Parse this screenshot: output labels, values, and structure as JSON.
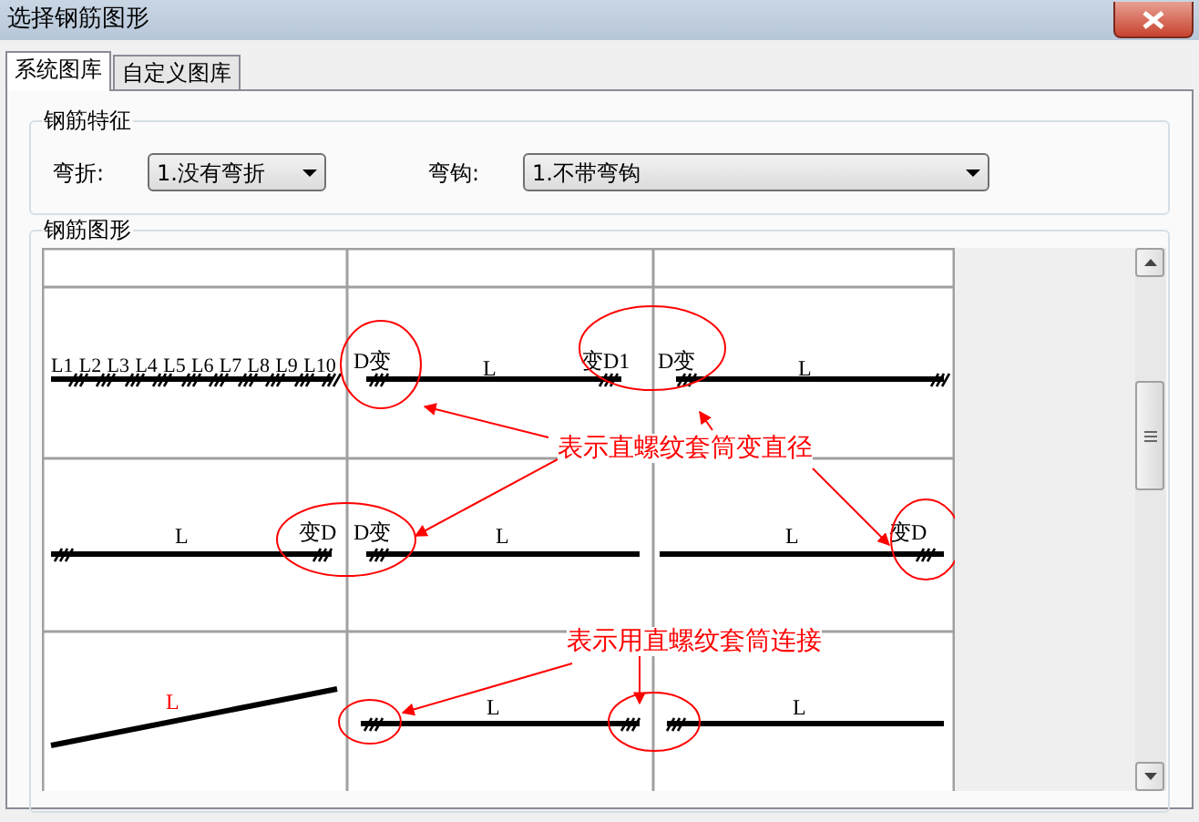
{
  "window": {
    "title": "选择钢筋图形"
  },
  "tabs": [
    {
      "label": "系统图库",
      "selected": true
    },
    {
      "label": "自定义图库",
      "selected": false
    }
  ],
  "features": {
    "title": "钢筋特征",
    "fields": [
      {
        "label": "弯折:",
        "value": "1.没有弯折"
      },
      {
        "label": "弯钩:",
        "value": "1.不带弯钩"
      }
    ]
  },
  "shapes": {
    "title": "钢筋图形",
    "cells": [
      {
        "color": "#000000",
        "labels": [
          "L1",
          "L2",
          "L3",
          "L4",
          "L5",
          "L6",
          "L7",
          "L8",
          "L9",
          "L10"
        ]
      },
      {
        "color": "#000000",
        "labels": [
          "D变",
          "L",
          "变D1"
        ]
      },
      {
        "color": "#000000",
        "labels": [
          "D变",
          "L"
        ]
      },
      {
        "color": "#000000",
        "labels": [
          "L",
          "变D"
        ]
      },
      {
        "color": "#000000",
        "labels": [
          "D变",
          "L"
        ]
      },
      {
        "color": "#000000",
        "labels": [
          "L",
          "变D"
        ]
      },
      {
        "color": "#ff0000",
        "labels": [
          "L"
        ]
      },
      {
        "color": "#000000",
        "labels": [
          "L"
        ]
      },
      {
        "color": "#000000",
        "labels": [
          "L"
        ]
      }
    ],
    "annotations": [
      "表示直螺纹套筒变直径",
      "表示用直螺纹套筒连接"
    ]
  }
}
